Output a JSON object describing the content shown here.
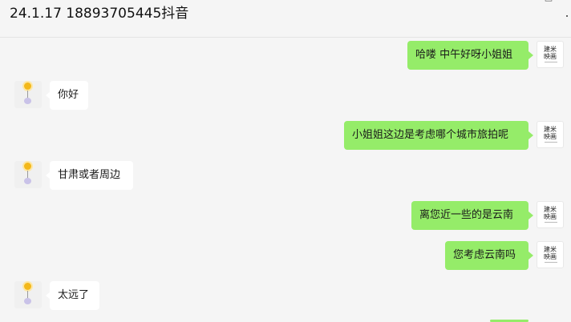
{
  "window": {
    "title": "24.1.17 18893705445抖音"
  },
  "icons": {
    "pin": "pin-icon",
    "maximize": "maximize-icon",
    "more": "more-icon"
  },
  "colors": {
    "outgoing_bubble": "#95ec69",
    "incoming_bubble": "#ffffff",
    "background": "#f5f5f5"
  },
  "self_avatar": {
    "logo_line1": "建米",
    "logo_line2": "映画"
  },
  "messages": [
    {
      "from": "self",
      "text": "哈喽 中午好呀小姐姐"
    },
    {
      "from": "contact",
      "text": "你好"
    },
    {
      "from": "self",
      "text": "小姐姐这边是考虑哪个城市旅拍呢"
    },
    {
      "from": "contact",
      "text": "甘肃或者周边"
    },
    {
      "from": "self",
      "text": "离您近一些的是云南"
    },
    {
      "from": "self",
      "text": "您考虑云南吗"
    },
    {
      "from": "contact",
      "text": "太远了"
    }
  ]
}
